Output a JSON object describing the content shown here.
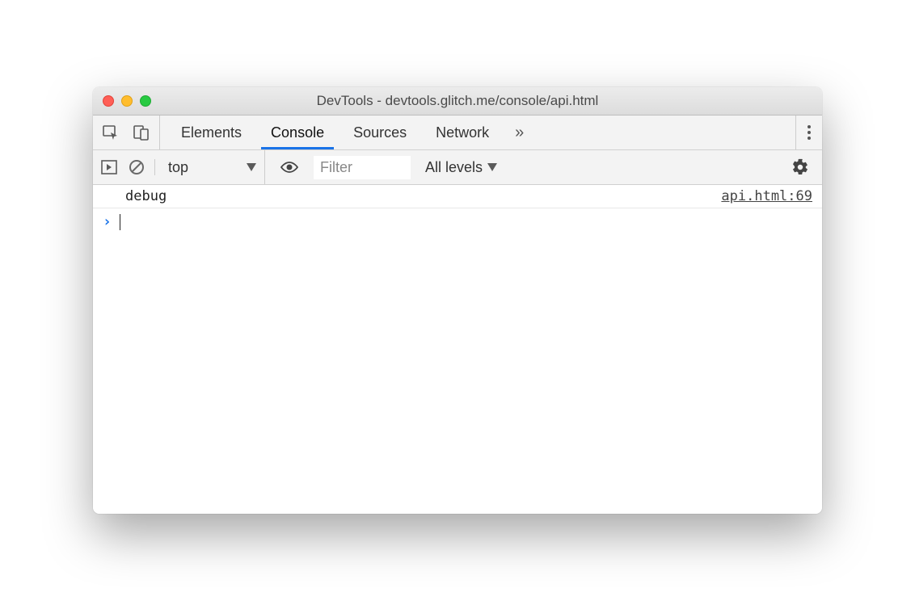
{
  "window": {
    "title": "DevTools - devtools.glitch.me/console/api.html"
  },
  "tabs": {
    "items": [
      "Elements",
      "Console",
      "Sources",
      "Network"
    ],
    "active_index": 1,
    "overflow_icon": "»"
  },
  "toolbar": {
    "context": "top",
    "filter_placeholder": "Filter",
    "levels_label": "All levels"
  },
  "console": {
    "log": {
      "message": "debug",
      "source": "api.html:69"
    },
    "prompt": "›"
  }
}
